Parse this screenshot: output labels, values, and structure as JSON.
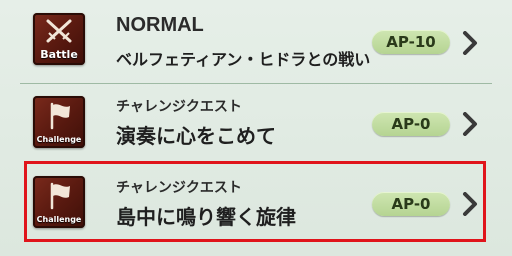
{
  "quests": [
    {
      "badge": "Battle",
      "badge_icon": "crossed-swords-icon",
      "subtitle": "NORMAL",
      "title": "ベルフェティアン・ヒドラとの戦い",
      "ap": "AP-10"
    },
    {
      "badge": "Challenge",
      "badge_icon": "flag-icon",
      "subtitle": "チャレンジクエスト",
      "title": "演奏に心をこめて",
      "ap": "AP-0"
    },
    {
      "badge": "Challenge",
      "badge_icon": "flag-icon",
      "subtitle": "チャレンジクエスト",
      "title": "島中に鳴り響く旋律",
      "ap": "AP-0",
      "selected": true
    }
  ],
  "colors": {
    "background": "#dde8df",
    "badge": "#6a2215",
    "ap_pill": "#c4dfa4",
    "chevron": "#3a3a3a",
    "selection": "#e0141b"
  }
}
